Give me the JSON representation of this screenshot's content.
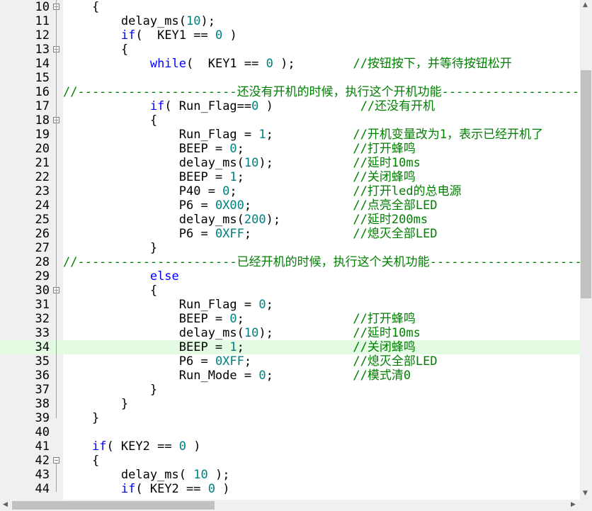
{
  "editor": {
    "highlight_line": 34,
    "lines": [
      {
        "n": "10",
        "fold": true,
        "toks": [
          {
            "t": "    {",
            "c": ""
          }
        ]
      },
      {
        "n": "11",
        "toks": [
          {
            "t": "        delay_ms(",
            "c": ""
          },
          {
            "t": "10",
            "c": "num"
          },
          {
            "t": ");",
            "c": ""
          }
        ]
      },
      {
        "n": "12",
        "toks": [
          {
            "t": "        ",
            "c": ""
          },
          {
            "t": "if",
            "c": "kw"
          },
          {
            "t": "(  KEY1 == ",
            "c": ""
          },
          {
            "t": "0",
            "c": "num"
          },
          {
            "t": " )",
            "c": ""
          }
        ]
      },
      {
        "n": "13",
        "fold": true,
        "toks": [
          {
            "t": "        {",
            "c": ""
          }
        ]
      },
      {
        "n": "14",
        "toks": [
          {
            "t": "            ",
            "c": ""
          },
          {
            "t": "while",
            "c": "kw"
          },
          {
            "t": "(  KEY1 == ",
            "c": ""
          },
          {
            "t": "0",
            "c": "num"
          },
          {
            "t": " );        ",
            "c": ""
          },
          {
            "t": "//按钮按下，并等待按钮松开",
            "c": "cm"
          }
        ]
      },
      {
        "n": "15",
        "toks": []
      },
      {
        "n": "16",
        "toks": [
          {
            "t": "//----------------------还没有开机的时候，执行这个开机功能--------------------",
            "c": "cm"
          }
        ]
      },
      {
        "n": "17",
        "toks": [
          {
            "t": "            ",
            "c": ""
          },
          {
            "t": "if",
            "c": "kw"
          },
          {
            "t": "( Run_Flag==",
            "c": ""
          },
          {
            "t": "0",
            "c": "num"
          },
          {
            "t": " )            ",
            "c": ""
          },
          {
            "t": "//还没有开机",
            "c": "cm"
          }
        ]
      },
      {
        "n": "18",
        "fold": true,
        "toks": [
          {
            "t": "            {",
            "c": ""
          }
        ]
      },
      {
        "n": "19",
        "toks": [
          {
            "t": "                Run_Flag = ",
            "c": ""
          },
          {
            "t": "1",
            "c": "num"
          },
          {
            "t": ";           ",
            "c": ""
          },
          {
            "t": "//开机变量改为1，表示已经开机了",
            "c": "cm"
          }
        ]
      },
      {
        "n": "20",
        "toks": [
          {
            "t": "                BEEP = ",
            "c": ""
          },
          {
            "t": "0",
            "c": "num"
          },
          {
            "t": ";               ",
            "c": ""
          },
          {
            "t": "//打开蜂鸣",
            "c": "cm"
          }
        ]
      },
      {
        "n": "21",
        "toks": [
          {
            "t": "                delay_ms(",
            "c": ""
          },
          {
            "t": "10",
            "c": "num"
          },
          {
            "t": ");           ",
            "c": ""
          },
          {
            "t": "//延时10ms",
            "c": "cm"
          }
        ]
      },
      {
        "n": "22",
        "toks": [
          {
            "t": "                BEEP = ",
            "c": ""
          },
          {
            "t": "1",
            "c": "num"
          },
          {
            "t": ";               ",
            "c": ""
          },
          {
            "t": "//关闭蜂鸣",
            "c": "cm"
          }
        ]
      },
      {
        "n": "23",
        "toks": [
          {
            "t": "                P40 = ",
            "c": ""
          },
          {
            "t": "0",
            "c": "num"
          },
          {
            "t": ";                ",
            "c": ""
          },
          {
            "t": "//打开led的总电源",
            "c": "cm"
          }
        ]
      },
      {
        "n": "24",
        "toks": [
          {
            "t": "                P6 = ",
            "c": ""
          },
          {
            "t": "0X00",
            "c": "num"
          },
          {
            "t": ";              ",
            "c": ""
          },
          {
            "t": "//点亮全部LED",
            "c": "cm"
          }
        ]
      },
      {
        "n": "25",
        "toks": [
          {
            "t": "                delay_ms(",
            "c": ""
          },
          {
            "t": "200",
            "c": "num"
          },
          {
            "t": ");          ",
            "c": ""
          },
          {
            "t": "//延时200ms",
            "c": "cm"
          }
        ]
      },
      {
        "n": "26",
        "toks": [
          {
            "t": "                P6 = ",
            "c": ""
          },
          {
            "t": "0XFF",
            "c": "num"
          },
          {
            "t": ";              ",
            "c": ""
          },
          {
            "t": "//熄灭全部LED",
            "c": "cm"
          }
        ]
      },
      {
        "n": "27",
        "fold_end": true,
        "toks": [
          {
            "t": "            }",
            "c": ""
          }
        ]
      },
      {
        "n": "28",
        "toks": [
          {
            "t": "//----------------------已经开机的时候，执行这个关机功能---------------------",
            "c": "cm"
          }
        ]
      },
      {
        "n": "29",
        "toks": [
          {
            "t": "            ",
            "c": ""
          },
          {
            "t": "else",
            "c": "kw"
          }
        ]
      },
      {
        "n": "30",
        "fold": true,
        "toks": [
          {
            "t": "            {",
            "c": ""
          }
        ]
      },
      {
        "n": "31",
        "toks": [
          {
            "t": "                Run_Flag = ",
            "c": ""
          },
          {
            "t": "0",
            "c": "num"
          },
          {
            "t": ";",
            "c": ""
          }
        ]
      },
      {
        "n": "32",
        "toks": [
          {
            "t": "                BEEP = ",
            "c": ""
          },
          {
            "t": "0",
            "c": "num"
          },
          {
            "t": ";               ",
            "c": ""
          },
          {
            "t": "//打开蜂鸣",
            "c": "cm"
          }
        ]
      },
      {
        "n": "33",
        "toks": [
          {
            "t": "                delay_ms(",
            "c": ""
          },
          {
            "t": "10",
            "c": "num"
          },
          {
            "t": ");           ",
            "c": ""
          },
          {
            "t": "//延时10ms",
            "c": "cm"
          }
        ]
      },
      {
        "n": "34",
        "toks": [
          {
            "t": "                BEEP = ",
            "c": ""
          },
          {
            "t": "1",
            "c": "num"
          },
          {
            "t": ";               ",
            "c": ""
          },
          {
            "t": "//关闭蜂鸣",
            "c": "cm"
          }
        ]
      },
      {
        "n": "35",
        "toks": [
          {
            "t": "                P6 = ",
            "c": ""
          },
          {
            "t": "0XFF",
            "c": "num"
          },
          {
            "t": ";              ",
            "c": ""
          },
          {
            "t": "//熄灭全部LED",
            "c": "cm"
          }
        ]
      },
      {
        "n": "36",
        "toks": [
          {
            "t": "                Run_Mode = ",
            "c": ""
          },
          {
            "t": "0",
            "c": "num"
          },
          {
            "t": ";           ",
            "c": ""
          },
          {
            "t": "//模式清0",
            "c": "cm"
          }
        ]
      },
      {
        "n": "37",
        "fold_end": true,
        "toks": [
          {
            "t": "            }",
            "c": ""
          }
        ]
      },
      {
        "n": "38",
        "fold_end": true,
        "toks": [
          {
            "t": "        }",
            "c": ""
          }
        ]
      },
      {
        "n": "39",
        "fold_end": true,
        "toks": [
          {
            "t": "    }",
            "c": ""
          }
        ]
      },
      {
        "n": "40",
        "toks": []
      },
      {
        "n": "41",
        "toks": [
          {
            "t": "    ",
            "c": ""
          },
          {
            "t": "if",
            "c": "kw"
          },
          {
            "t": "( KEY2 == ",
            "c": ""
          },
          {
            "t": "0",
            "c": "num"
          },
          {
            "t": " )",
            "c": ""
          }
        ]
      },
      {
        "n": "42",
        "fold": true,
        "toks": [
          {
            "t": "    {",
            "c": ""
          }
        ]
      },
      {
        "n": "43",
        "toks": [
          {
            "t": "        delay_ms( ",
            "c": ""
          },
          {
            "t": "10",
            "c": "num"
          },
          {
            "t": " );",
            "c": ""
          }
        ]
      },
      {
        "n": "44",
        "toks": [
          {
            "t": "        ",
            "c": ""
          },
          {
            "t": "if",
            "c": "kw"
          },
          {
            "t": "( KEY2 == ",
            "c": ""
          },
          {
            "t": "0",
            "c": "num"
          },
          {
            "t": " )",
            "c": ""
          }
        ]
      }
    ]
  },
  "colors": {
    "keyword": "#0000ff",
    "number": "#008080",
    "comment": "#008000",
    "highlight": "#e3fbe3"
  },
  "icons": {
    "fold": "fold-minus-icon",
    "scroll_up": "scroll-up-arrow-icon",
    "scroll_down": "scroll-down-arrow-icon",
    "scroll_left": "scroll-left-arrow-icon",
    "scroll_right": "scroll-right-arrow-icon"
  }
}
